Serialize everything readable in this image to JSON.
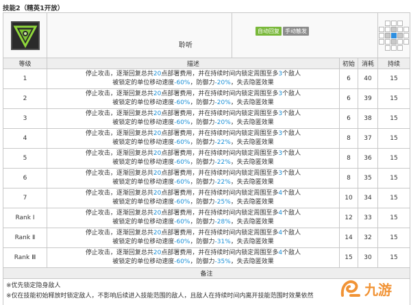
{
  "section_title": "技能2（精英1开放）",
  "skill": {
    "name": "聆听",
    "tags": [
      "自动回复",
      "手动触发"
    ],
    "icon_name": "skill-listen-icon",
    "range_grid": [
      [
        "none",
        "off",
        "off",
        "off",
        "none"
      ],
      [
        "off",
        "off",
        "on",
        "off",
        "off"
      ],
      [
        "off",
        "on",
        "self",
        "on",
        "off"
      ],
      [
        "off",
        "off",
        "on",
        "off",
        "off"
      ],
      [
        "none",
        "off",
        "off",
        "off",
        "none"
      ]
    ]
  },
  "table": {
    "headers": [
      "等级",
      "描述",
      "初始",
      "消耗",
      "持续"
    ],
    "desc_line1_prefix": "停止攻击，逐渐回复总共",
    "desc_line1_mid": "点部署费用，并在持续时间内锁定周围至多",
    "desc_line1_suffix": "个敌人",
    "desc_line2_prefix": "被锁定的单位移动速度",
    "desc_line2_mid": "，防御力",
    "desc_line2_suffix": "，失去隐匿效果",
    "rows": [
      {
        "level": "1",
        "cost_total": "20",
        "targets": "3",
        "speed": "-60%",
        "defense": "-20%",
        "initial": "6",
        "consume": "40",
        "duration": "15"
      },
      {
        "level": "2",
        "cost_total": "20",
        "targets": "3",
        "speed": "-60%",
        "defense": "-20%",
        "initial": "6",
        "consume": "39",
        "duration": "15"
      },
      {
        "level": "3",
        "cost_total": "20",
        "targets": "3",
        "speed": "-60%",
        "defense": "-20%",
        "initial": "6",
        "consume": "38",
        "duration": "15"
      },
      {
        "level": "4",
        "cost_total": "20",
        "targets": "3",
        "speed": "-60%",
        "defense": "-22%",
        "initial": "8",
        "consume": "37",
        "duration": "15"
      },
      {
        "level": "5",
        "cost_total": "20",
        "targets": "3",
        "speed": "-60%",
        "defense": "-22%",
        "initial": "8",
        "consume": "36",
        "duration": "15"
      },
      {
        "level": "6",
        "cost_total": "20",
        "targets": "3",
        "speed": "-60%",
        "defense": "-22%",
        "initial": "8",
        "consume": "35",
        "duration": "15"
      },
      {
        "level": "7",
        "cost_total": "20",
        "targets": "4",
        "speed": "-60%",
        "defense": "-25%",
        "initial": "10",
        "consume": "34",
        "duration": "15"
      },
      {
        "level": "Rank Ⅰ",
        "cost_total": "20",
        "targets": "4",
        "speed": "-60%",
        "defense": "-28%",
        "initial": "12",
        "consume": "33",
        "duration": "15"
      },
      {
        "level": "Rank Ⅱ",
        "cost_total": "20",
        "targets": "4",
        "speed": "-60%",
        "defense": "-31%",
        "initial": "14",
        "consume": "32",
        "duration": "15"
      },
      {
        "level": "Rank Ⅲ",
        "cost_total": "20",
        "targets": "4",
        "speed": "-60%",
        "defense": "-35%",
        "initial": "15",
        "consume": "30",
        "duration": "15"
      }
    ]
  },
  "notes": {
    "header": "备注",
    "lines": [
      "※优先锁定隐身敌人",
      "※仅在技能初始释放时锁定敌人，不影响后续进入技能范围的敌人，且敌人在持续时间内离开技能范围时效果依然"
    ]
  },
  "watermark": {
    "text": "九游",
    "icon_name": "jiuyou-logo-icon"
  },
  "colors": {
    "highlight": "#1a8fd6",
    "tag_auto": "#79b83a",
    "tag_manual": "#8c8c8c",
    "range_self": "#2e8fe0"
  }
}
